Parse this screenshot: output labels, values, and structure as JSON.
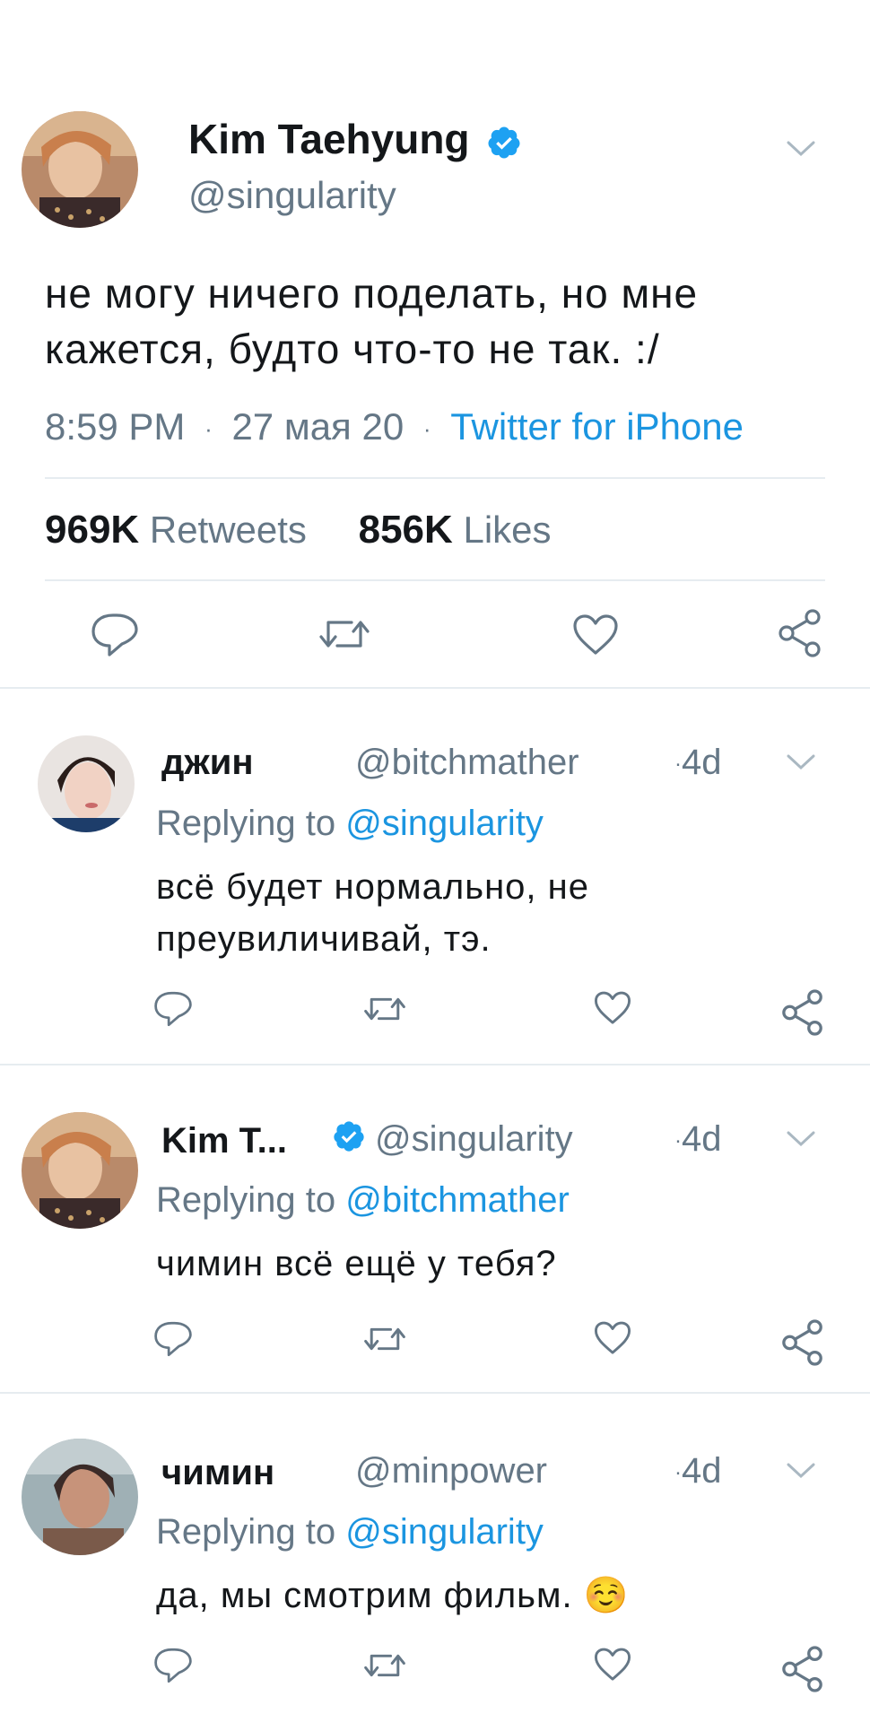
{
  "main_tweet": {
    "author_name": "Kim Taehyung",
    "author_handle": "@singularity",
    "verified": true,
    "text_line1": "не могу ничего поделать, но мне",
    "text_line2": "кажется, будто что-то не так. :/",
    "time": "8:59 PM",
    "date": "27 мая 20",
    "source": "Twitter for iPhone",
    "retweets_count": "969K",
    "retweets_label": "Retweets",
    "likes_count": "856K",
    "likes_label": "Likes"
  },
  "replies": [
    {
      "author_name": "джин",
      "author_handle": "@bitchmather",
      "verified": false,
      "time": "4d",
      "replying_prefix": "Replying to",
      "replying_to": "@singularity",
      "text_line1": "всё будет нормально, не",
      "text_line2": "преувиличивай, тэ."
    },
    {
      "author_name": "Kim T...",
      "author_handle": "@singularity",
      "verified": true,
      "time": "4d",
      "replying_prefix": "Replying to",
      "replying_to": "@bitchmather",
      "text_line1": "чимин всё ещё у тебя?",
      "text_line2": ""
    },
    {
      "author_name": "чимин",
      "author_handle": "@minpower",
      "verified": false,
      "time": "4d",
      "replying_prefix": "Replying to",
      "replying_to": "@singularity",
      "text_line1": "да, мы смотрим фильм. ☺️",
      "text_line2": ""
    }
  ],
  "colors": {
    "link": "#1b95e0",
    "muted": "#657786",
    "text": "#14171a",
    "separator": "#e6ecf0",
    "verified": "#1da1f2"
  },
  "icons": [
    "reply-icon",
    "retweet-icon",
    "like-icon",
    "share-icon",
    "chevron-down-icon",
    "verified-badge-icon"
  ]
}
